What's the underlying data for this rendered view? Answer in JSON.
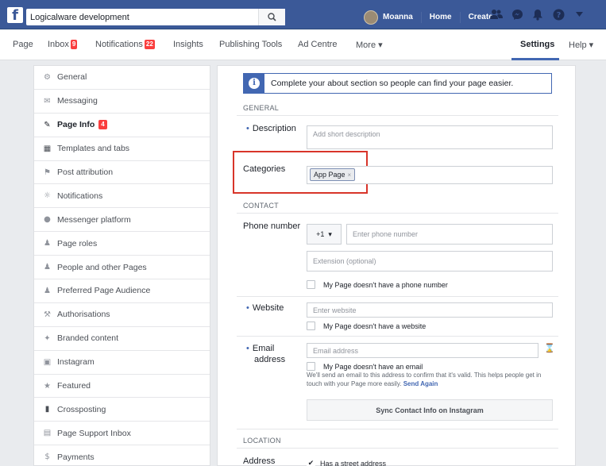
{
  "topbar": {
    "search_value": "Logicalware development",
    "user_name": "Moanna",
    "home_label": "Home",
    "create_label": "Create"
  },
  "pagenav": {
    "page": "Page",
    "inbox": "Inbox",
    "inbox_count": "9",
    "notifications": "Notifications",
    "notifications_count": "22",
    "insights": "Insights",
    "publishing_tools": "Publishing Tools",
    "ad_centre": "Ad Centre",
    "more": "More ▾",
    "settings": "Settings",
    "help": "Help ▾"
  },
  "sidebar": {
    "items": [
      {
        "label": "General",
        "icon": "gear-icon"
      },
      {
        "label": "Messaging",
        "icon": "chat-icon"
      },
      {
        "label": "Page Info",
        "icon": "pencil-icon",
        "badge": "4",
        "active": true
      },
      {
        "label": "Templates and tabs",
        "icon": "grid-icon"
      },
      {
        "label": "Post attribution",
        "icon": "flag-icon"
      },
      {
        "label": "Notifications",
        "icon": "globe-icon"
      },
      {
        "label": "Messenger platform",
        "icon": "messenger-icon"
      },
      {
        "label": "Page roles",
        "icon": "person-icon"
      },
      {
        "label": "People and other Pages",
        "icon": "people-icon"
      },
      {
        "label": "Preferred Page Audience",
        "icon": "audience-icon"
      },
      {
        "label": "Authorisations",
        "icon": "wrench-icon"
      },
      {
        "label": "Branded content",
        "icon": "handshake-icon"
      },
      {
        "label": "Instagram",
        "icon": "instagram-icon"
      },
      {
        "label": "Featured",
        "icon": "star-icon"
      },
      {
        "label": "Crossposting",
        "icon": "video-icon"
      },
      {
        "label": "Page Support Inbox",
        "icon": "inbox-icon"
      },
      {
        "label": "Payments",
        "icon": "dollar-icon"
      }
    ]
  },
  "main": {
    "banner_text": "Complete your about section so people can find your page easier.",
    "general_head": "GENERAL",
    "description_label": "Description",
    "description_placeholder": "Add short description",
    "categories_label": "Categories",
    "category_chip": "App Page",
    "contact_head": "CONTACT",
    "phone_label": "Phone number",
    "country_code": "+1",
    "phone_placeholder": "Enter phone number",
    "extension_placeholder": "Extension (optional)",
    "no_phone_label": "My Page doesn't have a phone number",
    "website_label": "Website",
    "website_placeholder": "Enter website",
    "no_website_label": "My Page doesn't have a website",
    "email_label_1": "Email",
    "email_label_2": "address",
    "email_placeholder": "Email address",
    "no_email_label": "My Page doesn't have an email",
    "email_help": "We'll send an email to this address to confirm that it's valid. This helps people get in touch with your Page more easily.",
    "send_again": "Send Again",
    "sync_button": "Sync Contact Info on Instagram",
    "location_head": "LOCATION",
    "address_label": "Address",
    "street_checkbox": "Has a street address"
  }
}
